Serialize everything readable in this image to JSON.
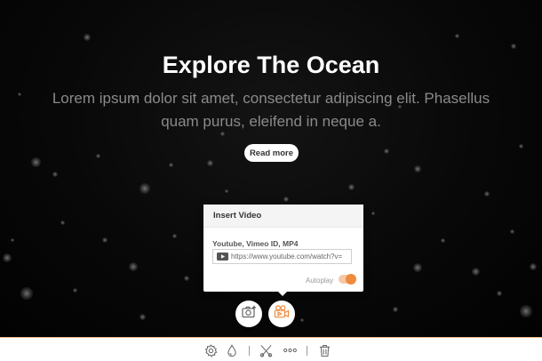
{
  "hero": {
    "title": "Explore The Ocean",
    "text": "Lorem ipsum dolor sit amet, consectetur adipiscing elit. Phasellus quam purus, eleifend in neque a.",
    "read_more_label": "Read more"
  },
  "insert_video": {
    "title": "Insert Video",
    "label": "Youtube, Vimeo ID, MP4",
    "url_value": "https://www.youtube.com/watch?v=",
    "autoplay_label": "Autoplay",
    "autoplay_on": true
  },
  "buttons": {
    "insert_image_icon": "camera-plus-icon",
    "insert_video_icon": "video-camera-icon"
  },
  "toolbar": {
    "icons": [
      "gear-icon",
      "droplet-icon",
      "scissors-icon",
      "more-dots-icon",
      "trash-icon"
    ]
  },
  "colors": {
    "accent": "#f08a3e",
    "background": "#050505",
    "toolbar_border": "#f0b787"
  }
}
